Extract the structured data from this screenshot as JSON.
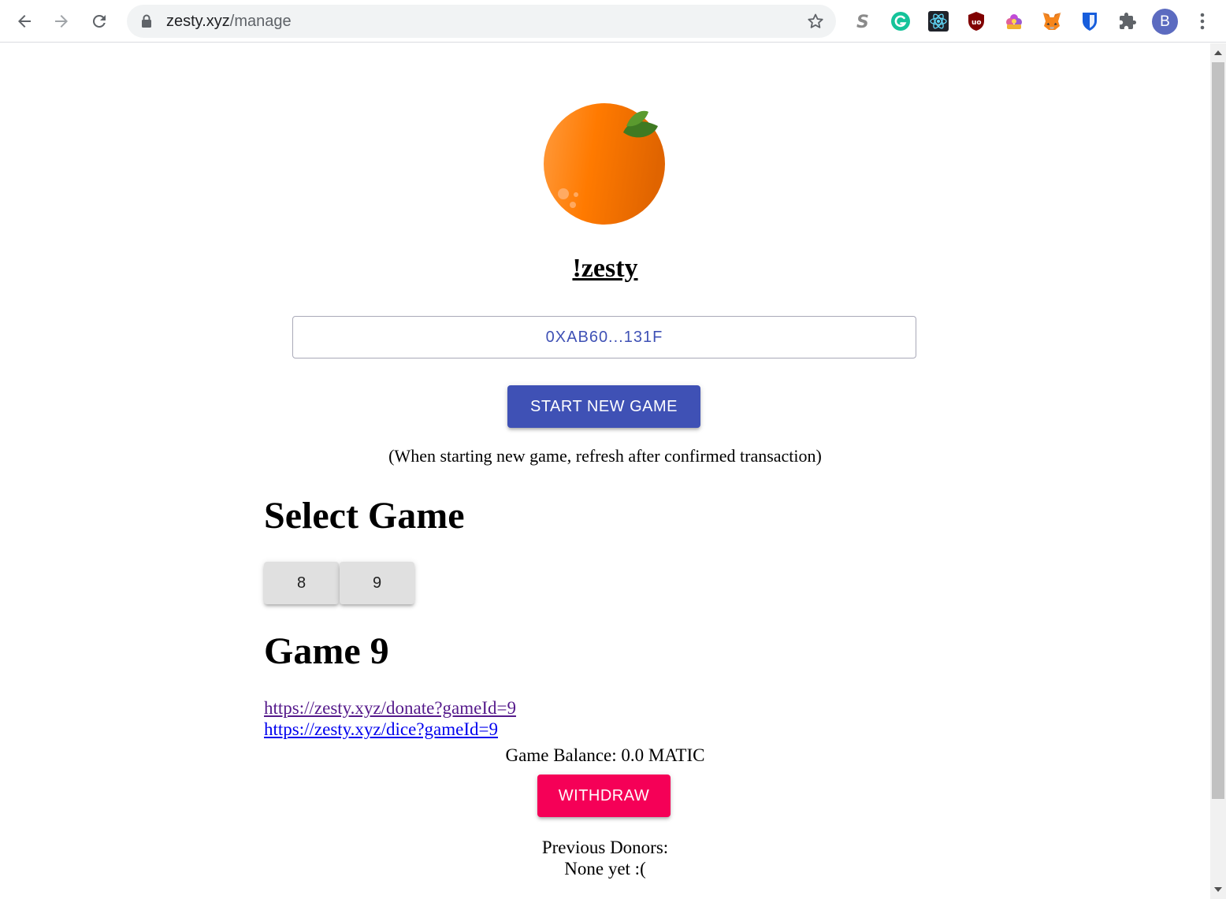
{
  "browser": {
    "url_host": "zesty.xyz",
    "url_path": "/manage",
    "profile_initial": "B"
  },
  "page": {
    "brand": "!zesty",
    "address": "0XAB60...131F",
    "start_button": "START NEW GAME",
    "start_note": "(When starting new game, refresh after confirmed transaction)",
    "select_heading": "Select Game",
    "games": [
      "8",
      "9"
    ],
    "game_heading": "Game 9",
    "donate_link": "https://zesty.xyz/donate?gameId=9",
    "dice_link": "https://zesty.xyz/dice?gameId=9",
    "balance": "Game Balance: 0.0 MATIC",
    "withdraw_button": "WITHDRAW",
    "donors_title": "Previous Donors:",
    "donors_none": "None yet :("
  },
  "colors": {
    "primary": "#3f51b5",
    "secondary": "#f50057",
    "orange": "#ff7a00",
    "leaf": "#3f7a22"
  },
  "icons": [
    "back-arrow-icon",
    "forward-arrow-icon",
    "reload-icon",
    "lock-icon",
    "star-icon",
    "extension-s-icon",
    "grammarly-icon",
    "react-devtools-icon",
    "ublock-icon",
    "extension-flower-icon",
    "metamask-icon",
    "bitwarden-icon",
    "puzzle-icon",
    "kebab-menu-icon",
    "orange-logo-icon"
  ]
}
